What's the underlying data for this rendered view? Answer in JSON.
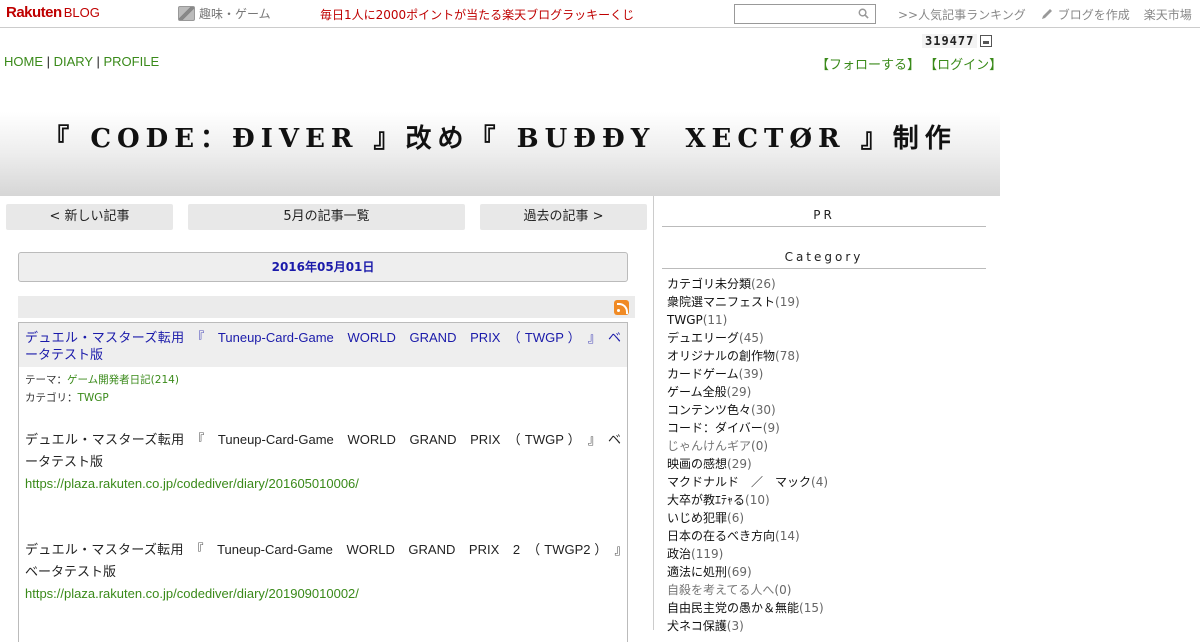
{
  "topbar": {
    "logo_main": "Rakuten",
    "logo_sub": "BLOG",
    "genre": "趣味・ゲーム",
    "lottery": "毎日1人に2000ポイントが当たる楽天ブログラッキーくじ",
    "search_placeholder": "",
    "ranking": ">>人気記事ランキング",
    "create_blog": "ブログを作成",
    "market": "楽天市場"
  },
  "header": {
    "counter": "319477",
    "nav": {
      "home": "HOME",
      "diary": "DIARY",
      "profile": "PROFILE",
      "sep": " | "
    },
    "follow": "【フォローする】",
    "login": "【ログイン】",
    "title": "『 CODE：ĐIVER 』改め『 BUĐĐY  XECTØR 』制作"
  },
  "pager": {
    "newer": "< 新しい記事",
    "month": "5月の記事一覧",
    "older": "過去の記事 >"
  },
  "entry": {
    "date": "2016年05月01日",
    "title": "デュエル・マスターズ転用　『　Tuneup-Card-Game　WORLD　GRAND　PRIX　（ TWGP ）　』　ベータテスト版",
    "theme_label": "テーマ：",
    "theme": "ゲーム開発者日記(214)",
    "category_label": "カテゴリ：",
    "category": "TWGP",
    "para1": "デュエル・マスターズ転用　『　Tuneup-Card-Game　WORLD　GRAND　PRIX　（ TWGP ）　』　ベータテスト版",
    "link1": "https://plaza.rakuten.co.jp/codediver/diary/201605010006/",
    "para2": "デュエル・マスターズ転用　『　Tuneup-Card-Game　WORLD　GRAND　PRIX　2　（ TWGP2 ）　』　ベータテスト版",
    "link2": "https://plaza.rakuten.co.jp/codediver/diary/201909010002/"
  },
  "sidebar": {
    "pr": "PR",
    "category_head": "Category",
    "categories": [
      {
        "name": "カテゴリ未分類",
        "count": "(26)",
        "grey": false
      },
      {
        "name": "衆院選マニフェスト",
        "count": "(19)",
        "grey": false
      },
      {
        "name": "TWGP",
        "count": "(11)",
        "grey": false
      },
      {
        "name": "デュエリーグ",
        "count": "(45)",
        "grey": false
      },
      {
        "name": "オリジナルの創作物",
        "count": "(78)",
        "grey": false
      },
      {
        "name": "カードゲーム",
        "count": "(39)",
        "grey": false
      },
      {
        "name": "ゲーム全般",
        "count": "(29)",
        "grey": false
      },
      {
        "name": "コンテンツ色々",
        "count": "(30)",
        "grey": false
      },
      {
        "name": "コード：ダイバー",
        "count": "(9)",
        "grey": false
      },
      {
        "name": "じゃんけんギア",
        "count": "(0)",
        "grey": true
      },
      {
        "name": "映画の感想",
        "count": "(29)",
        "grey": false
      },
      {
        "name": "マクドナルド　／　マック",
        "count": "(4)",
        "grey": false
      },
      {
        "name": "大卒が教ｴﾃｬる",
        "count": "(10)",
        "grey": false
      },
      {
        "name": "いじめ犯罪",
        "count": "(6)",
        "grey": false
      },
      {
        "name": "日本の在るべき方向",
        "count": "(14)",
        "grey": false
      },
      {
        "name": "政治",
        "count": "(119)",
        "grey": false
      },
      {
        "name": "適法に処刑",
        "count": "(69)",
        "grey": false
      },
      {
        "name": "自殺を考えてる人へ",
        "count": "(0)",
        "grey": true
      },
      {
        "name": "自由民主党の愚か＆無能",
        "count": "(15)",
        "grey": false
      },
      {
        "name": "犬ネコ保護",
        "count": "(3)",
        "grey": false
      }
    ]
  },
  "colors": {
    "rakuten_red": "#bf0000",
    "link_green": "#3a8a1a",
    "date_blue": "#1a1aaa",
    "rss_orange": "#f08a24"
  },
  "icons": [
    "genre-game-icon",
    "search-icon",
    "pen-icon",
    "counter-icon",
    "rss-icon"
  ]
}
